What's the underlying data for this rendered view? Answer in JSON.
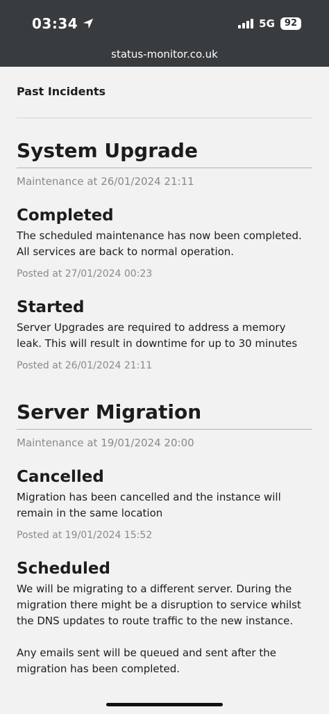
{
  "status_bar": {
    "time": "03:34",
    "network": "5G",
    "battery": "92"
  },
  "browser": {
    "url": "status-monitor.co.uk"
  },
  "page": {
    "section_title": "Past Incidents"
  },
  "incidents": [
    {
      "title": "System Upgrade",
      "meta": "Maintenance at 26/01/2024 21:11",
      "updates": [
        {
          "status": "Completed",
          "body": [
            "The scheduled maintenance has now been completed. All services are back to normal operation."
          ],
          "posted": "Posted at 27/01/2024 00:23"
        },
        {
          "status": "Started",
          "body": [
            "Server Upgrades are required to address a memory leak. This will result in downtime for up to 30 minutes"
          ],
          "posted": "Posted at 26/01/2024 21:11"
        }
      ]
    },
    {
      "title": "Server Migration",
      "meta": "Maintenance at 19/01/2024 20:00",
      "updates": [
        {
          "status": "Cancelled",
          "body": [
            "Migration has been cancelled and the instance will remain in the same location"
          ],
          "posted": "Posted at 19/01/2024 15:52"
        },
        {
          "status": "Scheduled",
          "body": [
            "We will be migrating to a different server. During the migration there might be a disruption to service whilst the DNS updates to route traffic to the new instance.",
            "Any emails sent will be queued and sent after the migration has been completed."
          ],
          "posted": ""
        }
      ]
    }
  ]
}
